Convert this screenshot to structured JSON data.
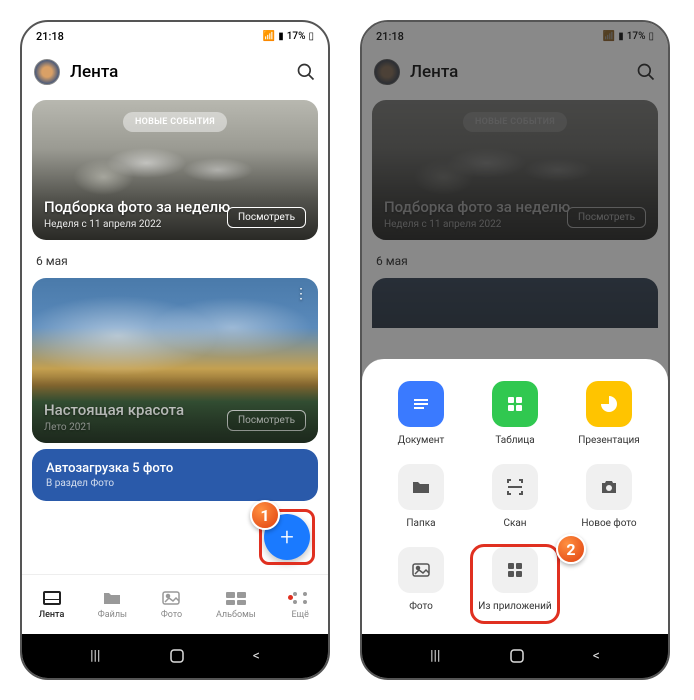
{
  "status": {
    "time": "21:18",
    "battery": "17%"
  },
  "header": {
    "title": "Лента"
  },
  "card1": {
    "badge": "НОВЫЕ СОБЫТИЯ",
    "title": "Подборка фото за неделю",
    "subtitle": "Неделя с 11 апреля 2022",
    "button": "Посмотреть"
  },
  "date_section": "6 мая",
  "card2": {
    "title": "Настоящая красота",
    "subtitle": "Лето 2021",
    "button": "Посмотреть"
  },
  "banner": {
    "title": "Автозагрузка 5 фото",
    "subtitle": "В раздел Фото"
  },
  "nav": {
    "items": [
      {
        "label": "Лента"
      },
      {
        "label": "Файлы"
      },
      {
        "label": "Фото"
      },
      {
        "label": "Альбомы"
      },
      {
        "label": "Ещё"
      }
    ]
  },
  "sheet": {
    "row1": [
      {
        "label": "Документ"
      },
      {
        "label": "Таблица"
      },
      {
        "label": "Презентация"
      }
    ],
    "row2": [
      {
        "label": "Папка"
      },
      {
        "label": "Скан"
      },
      {
        "label": "Новое фото"
      }
    ],
    "row3": [
      {
        "label": "Фото"
      },
      {
        "label": "Из приложений"
      },
      {
        "label": ""
      }
    ]
  },
  "callouts": {
    "one": "1",
    "two": "2"
  }
}
